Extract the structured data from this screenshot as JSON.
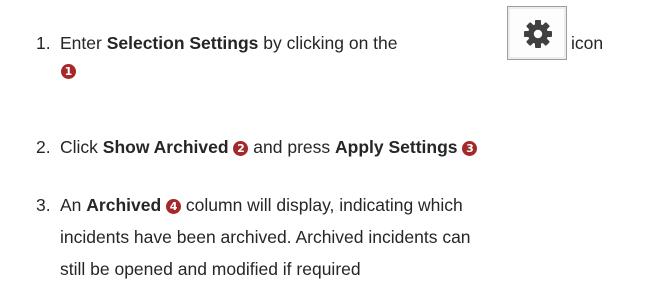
{
  "steps": [
    {
      "number": "1.",
      "text_before": "Enter ",
      "bold": "Selection Settings",
      "text_after": " by clicking on the",
      "icon": "gear-icon",
      "trailing_text": "icon",
      "badge": "1"
    },
    {
      "number": "2.",
      "text_before": "Click ",
      "bold_1": "Show Archived",
      "badge_1": "2",
      "text_middle": " and press ",
      "bold_2": "Apply Settings",
      "badge_2": "3"
    },
    {
      "number": "3.",
      "text_before": "An ",
      "bold": "Archived",
      "badge": "4",
      "line_1_rest": " column will display, indicating which",
      "line_2": "incidents have been archived.  Archived incidents can",
      "line_3": "still be opened and modified if required"
    }
  ],
  "colors": {
    "text": "#262626",
    "badge": "#a3292b",
    "icon": "#404040"
  }
}
